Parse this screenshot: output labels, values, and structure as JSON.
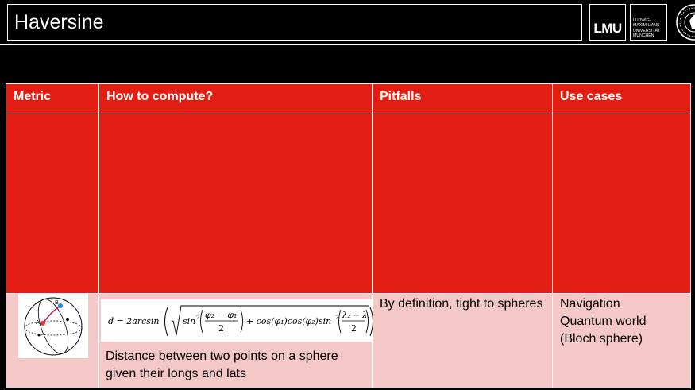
{
  "header": {
    "title": "Haversine",
    "logo_text": "LMU",
    "university_lines": [
      "Ludwig-",
      "Maximilians-",
      "Universität",
      "München"
    ]
  },
  "table": {
    "columns": [
      "Metric",
      "How to compute?",
      "Pitfalls",
      "Use cases"
    ],
    "row": {
      "formula": "d = 2arcsin( √( sin²((φ₂ − φ₁)/2) + cos(φ₁)cos(φ₂)sin²((λ₂ − λ₁)/2) ) )",
      "description": "Distance between two points on a sphere given their longs and lats",
      "pitfalls": "By definition, tight to spheres",
      "use_cases": [
        "Navigation",
        "Quantum world",
        "(Bloch sphere)"
      ]
    }
  },
  "sphere_labels": {
    "a": "A",
    "b": "B"
  },
  "colors": {
    "header_red": "#e41d12",
    "row_pink": "#f5c8c8",
    "background": "#000000"
  }
}
